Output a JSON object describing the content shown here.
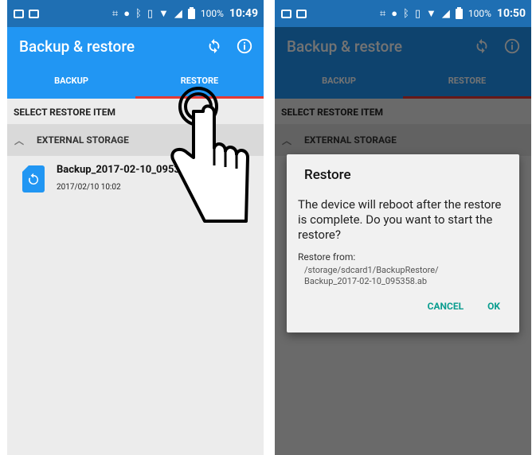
{
  "status_bar": [
    {
      "battery_pct": "100%",
      "time": "10:49"
    },
    {
      "battery_pct": "100%",
      "time": "10:50"
    }
  ],
  "app": {
    "title": "Backup & restore",
    "icons": [
      "sync-icon",
      "info-icon"
    ]
  },
  "tabs": [
    {
      "label": "BACKUP",
      "active": false
    },
    {
      "label": "RESTORE",
      "active": true
    }
  ],
  "section_title": "SELECT RESTORE ITEM",
  "group": {
    "label": "EXTERNAL STORAGE",
    "expanded": true
  },
  "items": [
    {
      "name": "Backup_2017-02-10_095358.ab",
      "date": "2017/02/10 10:02"
    }
  ],
  "dialog": {
    "title": "Restore",
    "message": "The device will reboot after the restore is complete. Do you want to start the restore?",
    "from_label": "Restore from:",
    "path": "/storage/sdcard1/BackupRestore/\nBackup_2017-02-10_095358.ab",
    "cancel": "CANCEL",
    "ok": "OK"
  },
  "colors": {
    "app_bar": "#2196f3",
    "status_bar": "#1f6fb3",
    "tab_indicator": "#e53935",
    "dialog_button": "#0a9d8f"
  }
}
